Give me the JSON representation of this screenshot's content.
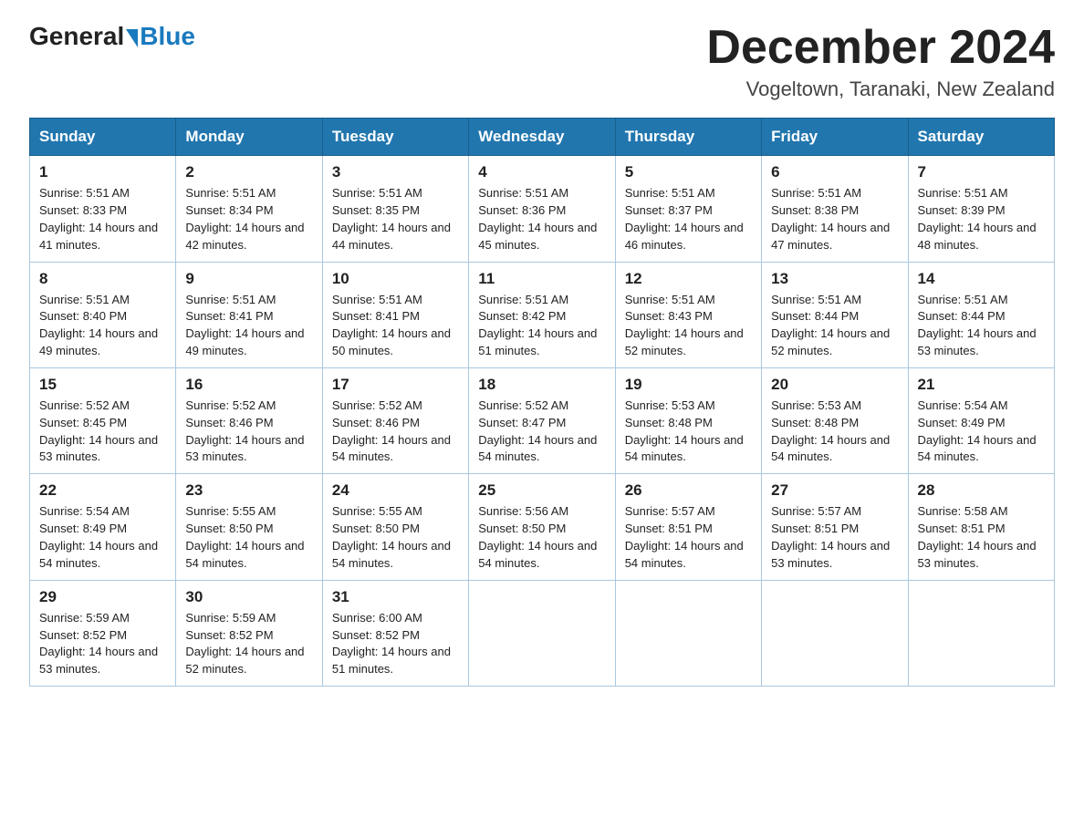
{
  "header": {
    "logo_general": "General",
    "logo_blue": "Blue",
    "title": "December 2024",
    "subtitle": "Vogeltown, Taranaki, New Zealand"
  },
  "weekdays": [
    "Sunday",
    "Monday",
    "Tuesday",
    "Wednesday",
    "Thursday",
    "Friday",
    "Saturday"
  ],
  "weeks": [
    [
      {
        "day": "1",
        "sunrise": "5:51 AM",
        "sunset": "8:33 PM",
        "daylight": "14 hours and 41 minutes."
      },
      {
        "day": "2",
        "sunrise": "5:51 AM",
        "sunset": "8:34 PM",
        "daylight": "14 hours and 42 minutes."
      },
      {
        "day": "3",
        "sunrise": "5:51 AM",
        "sunset": "8:35 PM",
        "daylight": "14 hours and 44 minutes."
      },
      {
        "day": "4",
        "sunrise": "5:51 AM",
        "sunset": "8:36 PM",
        "daylight": "14 hours and 45 minutes."
      },
      {
        "day": "5",
        "sunrise": "5:51 AM",
        "sunset": "8:37 PM",
        "daylight": "14 hours and 46 minutes."
      },
      {
        "day": "6",
        "sunrise": "5:51 AM",
        "sunset": "8:38 PM",
        "daylight": "14 hours and 47 minutes."
      },
      {
        "day": "7",
        "sunrise": "5:51 AM",
        "sunset": "8:39 PM",
        "daylight": "14 hours and 48 minutes."
      }
    ],
    [
      {
        "day": "8",
        "sunrise": "5:51 AM",
        "sunset": "8:40 PM",
        "daylight": "14 hours and 49 minutes."
      },
      {
        "day": "9",
        "sunrise": "5:51 AM",
        "sunset": "8:41 PM",
        "daylight": "14 hours and 49 minutes."
      },
      {
        "day": "10",
        "sunrise": "5:51 AM",
        "sunset": "8:41 PM",
        "daylight": "14 hours and 50 minutes."
      },
      {
        "day": "11",
        "sunrise": "5:51 AM",
        "sunset": "8:42 PM",
        "daylight": "14 hours and 51 minutes."
      },
      {
        "day": "12",
        "sunrise": "5:51 AM",
        "sunset": "8:43 PM",
        "daylight": "14 hours and 52 minutes."
      },
      {
        "day": "13",
        "sunrise": "5:51 AM",
        "sunset": "8:44 PM",
        "daylight": "14 hours and 52 minutes."
      },
      {
        "day": "14",
        "sunrise": "5:51 AM",
        "sunset": "8:44 PM",
        "daylight": "14 hours and 53 minutes."
      }
    ],
    [
      {
        "day": "15",
        "sunrise": "5:52 AM",
        "sunset": "8:45 PM",
        "daylight": "14 hours and 53 minutes."
      },
      {
        "day": "16",
        "sunrise": "5:52 AM",
        "sunset": "8:46 PM",
        "daylight": "14 hours and 53 minutes."
      },
      {
        "day": "17",
        "sunrise": "5:52 AM",
        "sunset": "8:46 PM",
        "daylight": "14 hours and 54 minutes."
      },
      {
        "day": "18",
        "sunrise": "5:52 AM",
        "sunset": "8:47 PM",
        "daylight": "14 hours and 54 minutes."
      },
      {
        "day": "19",
        "sunrise": "5:53 AM",
        "sunset": "8:48 PM",
        "daylight": "14 hours and 54 minutes."
      },
      {
        "day": "20",
        "sunrise": "5:53 AM",
        "sunset": "8:48 PM",
        "daylight": "14 hours and 54 minutes."
      },
      {
        "day": "21",
        "sunrise": "5:54 AM",
        "sunset": "8:49 PM",
        "daylight": "14 hours and 54 minutes."
      }
    ],
    [
      {
        "day": "22",
        "sunrise": "5:54 AM",
        "sunset": "8:49 PM",
        "daylight": "14 hours and 54 minutes."
      },
      {
        "day": "23",
        "sunrise": "5:55 AM",
        "sunset": "8:50 PM",
        "daylight": "14 hours and 54 minutes."
      },
      {
        "day": "24",
        "sunrise": "5:55 AM",
        "sunset": "8:50 PM",
        "daylight": "14 hours and 54 minutes."
      },
      {
        "day": "25",
        "sunrise": "5:56 AM",
        "sunset": "8:50 PM",
        "daylight": "14 hours and 54 minutes."
      },
      {
        "day": "26",
        "sunrise": "5:57 AM",
        "sunset": "8:51 PM",
        "daylight": "14 hours and 54 minutes."
      },
      {
        "day": "27",
        "sunrise": "5:57 AM",
        "sunset": "8:51 PM",
        "daylight": "14 hours and 53 minutes."
      },
      {
        "day": "28",
        "sunrise": "5:58 AM",
        "sunset": "8:51 PM",
        "daylight": "14 hours and 53 minutes."
      }
    ],
    [
      {
        "day": "29",
        "sunrise": "5:59 AM",
        "sunset": "8:52 PM",
        "daylight": "14 hours and 53 minutes."
      },
      {
        "day": "30",
        "sunrise": "5:59 AM",
        "sunset": "8:52 PM",
        "daylight": "14 hours and 52 minutes."
      },
      {
        "day": "31",
        "sunrise": "6:00 AM",
        "sunset": "8:52 PM",
        "daylight": "14 hours and 51 minutes."
      },
      null,
      null,
      null,
      null
    ]
  ]
}
